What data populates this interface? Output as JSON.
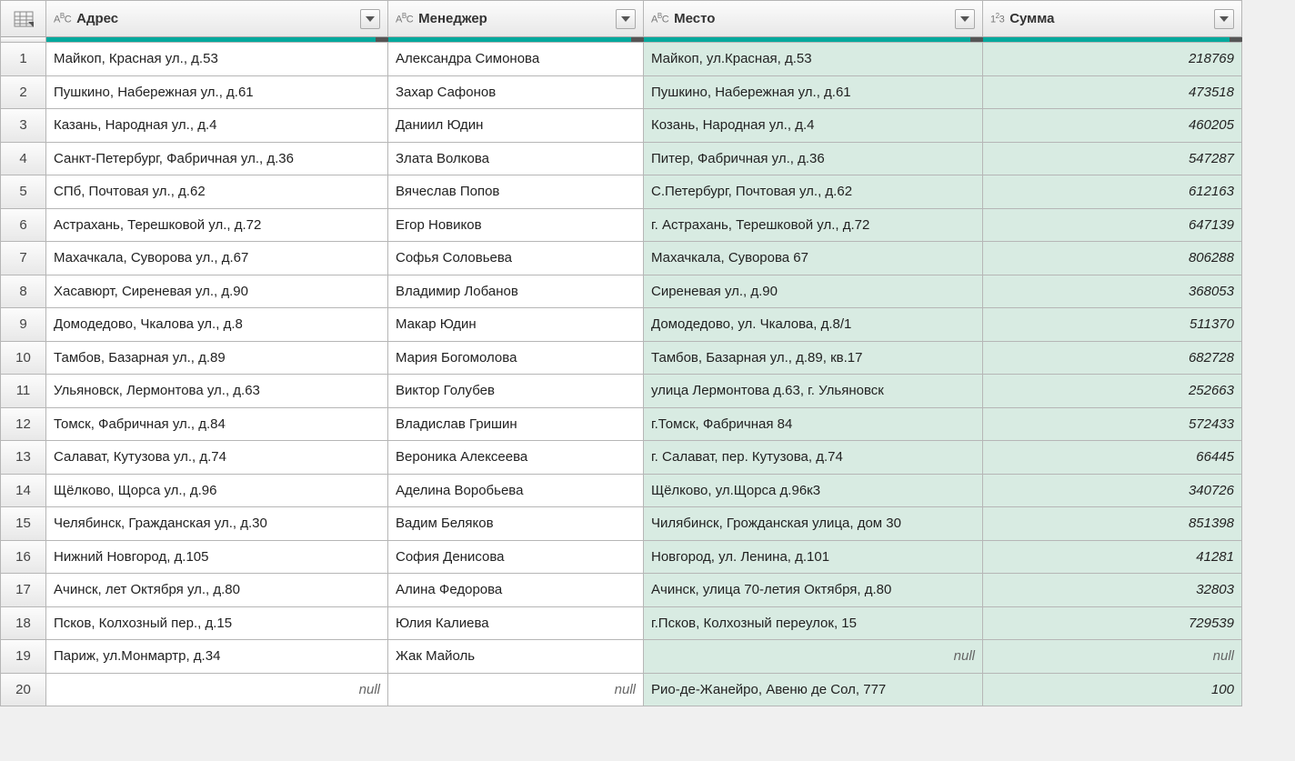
{
  "columns": [
    {
      "label": "Адрес",
      "type": "text",
      "typeIcon": "AВC"
    },
    {
      "label": "Менеджер",
      "type": "text",
      "typeIcon": "AВC"
    },
    {
      "label": "Место",
      "type": "text",
      "typeIcon": "AВC",
      "added": true
    },
    {
      "label": "Сумма",
      "type": "number",
      "typeIcon": "1²3",
      "added": true
    }
  ],
  "nullLabel": "null",
  "rows": [
    {
      "n": 1,
      "address": "Майкоп, Красная ул., д.53",
      "manager": "Александра Симонова",
      "place": "Майкоп, ул.Красная, д.53",
      "sum": 218769
    },
    {
      "n": 2,
      "address": "Пушкино, Набережная ул., д.61",
      "manager": "Захар Сафонов",
      "place": "Пушкино, Набережная ул., д.61",
      "sum": 473518
    },
    {
      "n": 3,
      "address": "Казань, Народная ул., д.4",
      "manager": "Даниил Юдин",
      "place": "Козань, Народная ул., д.4",
      "sum": 460205
    },
    {
      "n": 4,
      "address": "Санкт-Петербург, Фабричная ул., д.36",
      "manager": "Злата Волкова",
      "place": "Питер, Фабричная ул., д.36",
      "sum": 547287
    },
    {
      "n": 5,
      "address": "СПб, Почтовая ул., д.62",
      "manager": "Вячеслав Попов",
      "place": "С.Петербург, Почтовая ул., д.62",
      "sum": 612163
    },
    {
      "n": 6,
      "address": "Астрахань, Терешковой ул., д.72",
      "manager": "Егор Новиков",
      "place": "г. Астрахань, Терешковой ул., д.72",
      "sum": 647139
    },
    {
      "n": 7,
      "address": "Махачкала, Суворова ул., д.67",
      "manager": "Софья Соловьева",
      "place": "Махачкала, Суворова 67",
      "sum": 806288
    },
    {
      "n": 8,
      "address": "Хасавюрт, Сиреневая ул., д.90",
      "manager": "Владимир Лобанов",
      "place": "Сиреневая ул., д.90",
      "sum": 368053
    },
    {
      "n": 9,
      "address": "Домодедово, Чкалова ул., д.8",
      "manager": "Макар Юдин",
      "place": "Домодедово, ул. Чкалова, д.8/1",
      "sum": 511370
    },
    {
      "n": 10,
      "address": "Тамбов, Базарная ул., д.89",
      "manager": "Мария Богомолова",
      "place": "Тамбов, Базарная ул., д.89, кв.17",
      "sum": 682728
    },
    {
      "n": 11,
      "address": "Ульяновск, Лермонтова ул., д.63",
      "manager": "Виктор Голубев",
      "place": "улица Лермонтова д.63, г. Ульяновск",
      "sum": 252663
    },
    {
      "n": 12,
      "address": "Томск, Фабричная ул., д.84",
      "manager": "Владислав Гришин",
      "place": "г.Томск, Фабричная 84",
      "sum": 572433
    },
    {
      "n": 13,
      "address": "Салават, Кутузова ул., д.74",
      "manager": "Вероника Алексеева",
      "place": "г. Салават, пер. Кутузова, д.74",
      "sum": 66445
    },
    {
      "n": 14,
      "address": "Щёлково, Щорса ул., д.96",
      "manager": "Аделина Воробьева",
      "place": "Щёлково, ул.Щорса д.96к3",
      "sum": 340726
    },
    {
      "n": 15,
      "address": "Челябинск, Гражданская ул., д.30",
      "manager": "Вадим Беляков",
      "place": "Чилябинск, Грожданская улица, дом 30",
      "sum": 851398
    },
    {
      "n": 16,
      "address": "Нижний Новгород, д.105",
      "manager": "София Денисова",
      "place": "Новгород, ул. Ленина, д.101",
      "sum": 41281
    },
    {
      "n": 17,
      "address": "Ачинск, лет Октября ул., д.80",
      "manager": "Алина Федорова",
      "place": "Ачинск, улица 70-летия Октября, д.80",
      "sum": 32803
    },
    {
      "n": 18,
      "address": "Псков, Колхозный пер., д.15",
      "manager": "Юлия Калиева",
      "place": "г.Псков, Колхозный переулок, 15",
      "sum": 729539
    },
    {
      "n": 19,
      "address": "Париж, ул.Монмартр, д.34",
      "manager": "Жак Майоль",
      "place": null,
      "sum": null
    },
    {
      "n": 20,
      "address": null,
      "manager": null,
      "place": "Рио-де-Жанейро, Авеню де Сол, 777",
      "sum": 100
    }
  ]
}
